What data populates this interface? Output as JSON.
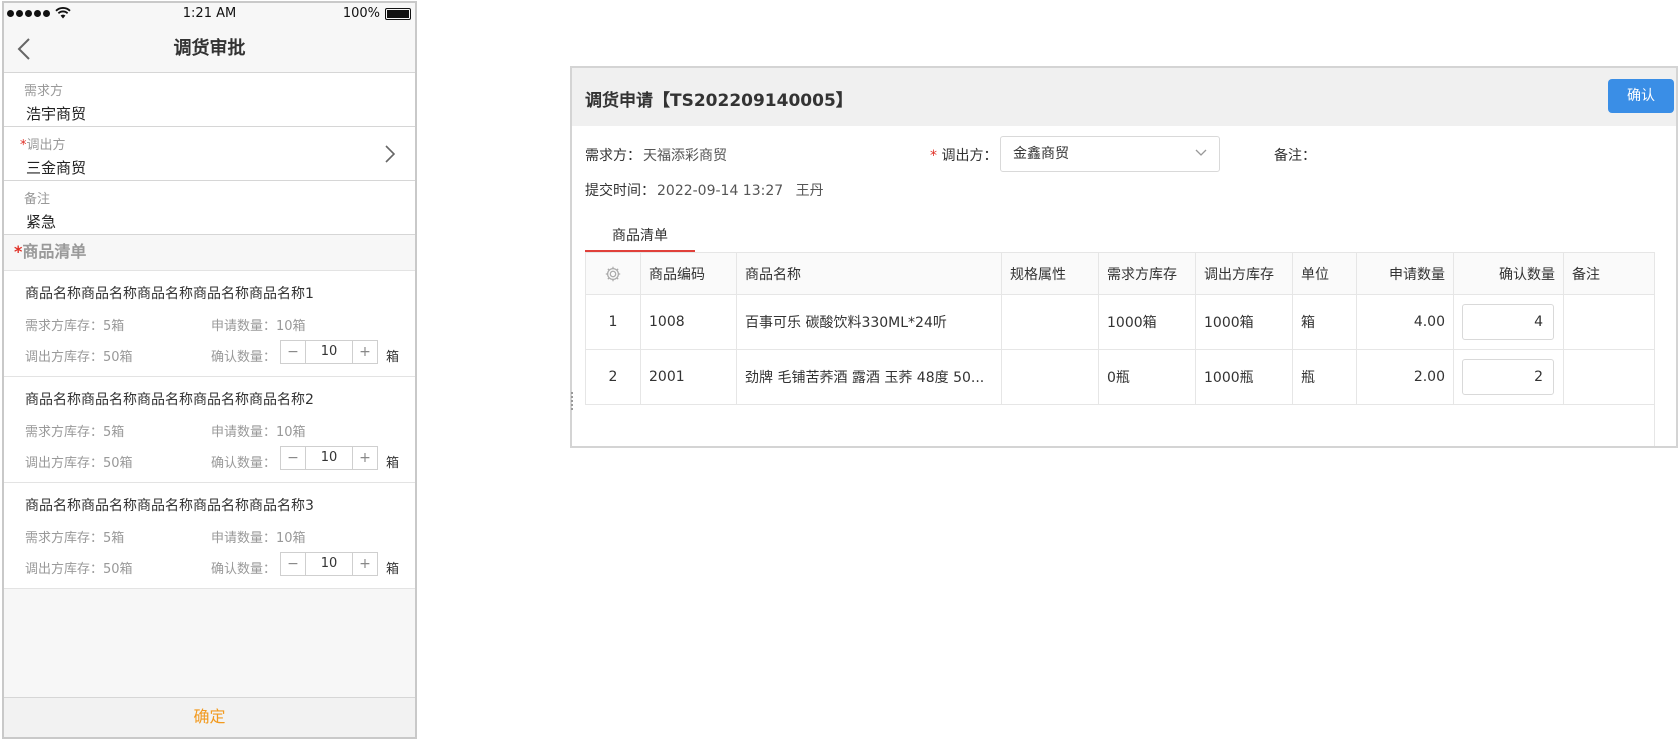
{
  "mobile": {
    "status": {
      "time": "1:21 AM",
      "battery": "100%"
    },
    "nav": {
      "title": "调货审批"
    },
    "demand": {
      "label": "需求方",
      "value": "浩宇商贸"
    },
    "supplier": {
      "required": "*",
      "label": "调出方",
      "value": "三金商贸"
    },
    "remark": {
      "label": "备注",
      "value": "紧急"
    },
    "goods_section": {
      "required": "*",
      "title": "商品清单"
    },
    "goods": [
      {
        "name": "商品名称商品名称商品名称商品名称商品名称1",
        "demand_stock": "需求方库存：5箱",
        "apply_qty": "申请数量：10箱",
        "supply_stock": "调出方库存：50箱",
        "confirm_label": "确认数量：",
        "confirm_value": "10",
        "unit": "箱",
        "minus": "−",
        "plus": "+"
      },
      {
        "name": "商品名称商品名称商品名称商品名称商品名称2",
        "demand_stock": "需求方库存：5箱",
        "apply_qty": "申请数量：10箱",
        "supply_stock": "调出方库存：50箱",
        "confirm_label": "确认数量：",
        "confirm_value": "10",
        "unit": "箱",
        "minus": "−",
        "plus": "+"
      },
      {
        "name": "商品名称商品名称商品名称商品名称商品名称3",
        "demand_stock": "需求方库存：5箱",
        "apply_qty": "申请数量：10箱",
        "supply_stock": "调出方库存：50箱",
        "confirm_label": "确认数量：",
        "confirm_value": "10",
        "unit": "箱",
        "minus": "−",
        "plus": "+"
      }
    ],
    "footer": {
      "confirm_label": "确定"
    }
  },
  "dialog": {
    "title": "调货申请【TS202209140005】",
    "confirm_label": "确认",
    "demand_label": "需求方：",
    "demand_value": "天福添彩商贸",
    "supplier_required": "*",
    "supplier_label": "调出方：",
    "supplier_value": "金鑫商贸",
    "remark_label": "备注：",
    "submit_label": "提交时间：",
    "submit_value": "2022-09-14 13:27",
    "submitter": "王丹",
    "tab_label": "商品清单",
    "columns": [
      "商品编码",
      "商品名称",
      "规格属性",
      "需求方库存",
      "调出方库存",
      "单位",
      "申请数量",
      "确认数量",
      "备注"
    ],
    "rows": [
      {
        "index": "1",
        "code": "1008",
        "name": "百事可乐 碳酸饮料330ML*24听",
        "spec": "",
        "demand_stock": "1000箱",
        "supply_stock": "1000箱",
        "unit": "箱",
        "apply_qty": "4.00",
        "confirm_qty": "4",
        "remark": ""
      },
      {
        "index": "2",
        "code": "2001",
        "name": "劲牌 毛铺苦荞酒 露酒 玉荞 48度 50...",
        "spec": "",
        "demand_stock": "0瓶",
        "supply_stock": "1000瓶",
        "unit": "瓶",
        "apply_qty": "2.00",
        "confirm_qty": "2",
        "remark": ""
      }
    ]
  },
  "colors": {
    "accent_blue": "#3a8ee6",
    "accent_orange": "#f29a1f",
    "required_red": "#e02e24",
    "tab_underline": "#e0403a"
  }
}
